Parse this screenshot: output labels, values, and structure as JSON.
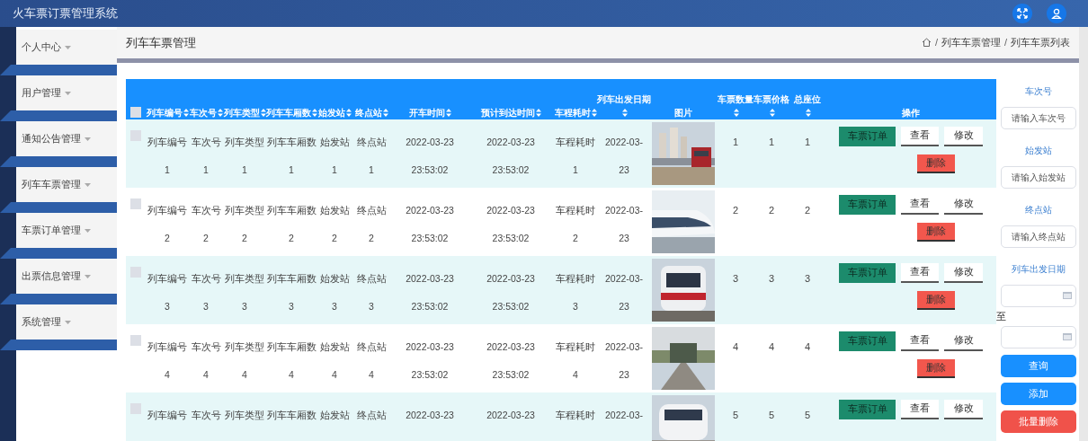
{
  "app_title": "火车票订票管理系统",
  "sidebar": {
    "items": [
      {
        "label": "个人中心"
      },
      {
        "label": "用户管理"
      },
      {
        "label": "通知公告管理"
      },
      {
        "label": "列车车票管理"
      },
      {
        "label": "车票订单管理"
      },
      {
        "label": "出票信息管理"
      },
      {
        "label": "系统管理"
      }
    ]
  },
  "page_title": "列车车票管理",
  "breadcrumb": [
    {
      "kind": "separator",
      "text": "/"
    },
    {
      "kind": "link",
      "text": "列车车票管理"
    },
    {
      "kind": "separator",
      "text": "/"
    },
    {
      "kind": "link",
      "text": "列车车票列表"
    }
  ],
  "table": {
    "select_all_checked": false,
    "columns": [
      {
        "label": "列车编号",
        "sortable": true
      },
      {
        "label": "车次号",
        "sortable": true
      },
      {
        "label": "列车类型",
        "sortable": true
      },
      {
        "label": "列车车厢数",
        "sortable": true
      },
      {
        "label": "始发站",
        "sortable": true
      },
      {
        "label": "终点站",
        "sortable": true
      },
      {
        "label": "开车时间",
        "sortable": true
      },
      {
        "label": "预计到达时间",
        "sortable": true
      },
      {
        "label": "车程耗时",
        "sortable": true
      },
      {
        "top_label": "列车出发日期",
        "sortable": true
      },
      {
        "label": "图片",
        "sortable": false
      },
      {
        "top_label": "车票数量",
        "sortable": true
      },
      {
        "top_label": "车票价格",
        "sortable": true
      },
      {
        "top_label": "总座位",
        "sortable": true
      },
      {
        "label": "操作",
        "sortable": false
      }
    ],
    "rows": [
      {
        "checked": false,
        "cells": [
          [
            "列车编号",
            "1"
          ],
          [
            "车次号",
            "1"
          ],
          [
            "列车类型",
            "1"
          ],
          [
            "列车车厢数",
            "1"
          ],
          [
            "始发站",
            "1"
          ],
          [
            "终点站",
            "1"
          ],
          [
            "2022-03-23",
            "23:53:02"
          ],
          [
            "2022-03-23",
            "23:53:02"
          ],
          [
            "车程耗时",
            "1"
          ],
          [
            "2022-03-",
            "23"
          ]
        ],
        "counts": [
          "1",
          "1",
          "1"
        ],
        "actions": [
          {
            "label": "车票订单",
            "kind": "order"
          },
          {
            "label": "查看",
            "kind": "view"
          },
          {
            "label": "修改",
            "kind": "edit"
          },
          {
            "label": "删除",
            "kind": "delete"
          }
        ]
      },
      {
        "checked": false,
        "cells": [
          [
            "列车编号",
            "2"
          ],
          [
            "车次号",
            "2"
          ],
          [
            "列车类型",
            "2"
          ],
          [
            "列车车厢数",
            "2"
          ],
          [
            "始发站",
            "2"
          ],
          [
            "终点站",
            "2"
          ],
          [
            "2022-03-23",
            "23:53:02"
          ],
          [
            "2022-03-23",
            "23:53:02"
          ],
          [
            "车程耗时",
            "2"
          ],
          [
            "2022-03-",
            "23"
          ]
        ],
        "counts": [
          "2",
          "2",
          "2"
        ],
        "actions": [
          {
            "label": "车票订单",
            "kind": "order"
          },
          {
            "label": "查看",
            "kind": "view"
          },
          {
            "label": "修改",
            "kind": "edit"
          },
          {
            "label": "删除",
            "kind": "delete"
          }
        ]
      },
      {
        "checked": false,
        "cells": [
          [
            "列车编号",
            "3"
          ],
          [
            "车次号",
            "3"
          ],
          [
            "列车类型",
            "3"
          ],
          [
            "列车车厢数",
            "3"
          ],
          [
            "始发站",
            "3"
          ],
          [
            "终点站",
            "3"
          ],
          [
            "2022-03-23",
            "23:53:02"
          ],
          [
            "2022-03-23",
            "23:53:02"
          ],
          [
            "车程耗时",
            "3"
          ],
          [
            "2022-03-",
            "23"
          ]
        ],
        "counts": [
          "3",
          "3",
          "3"
        ],
        "actions": [
          {
            "label": "车票订单",
            "kind": "order"
          },
          {
            "label": "查看",
            "kind": "view"
          },
          {
            "label": "修改",
            "kind": "edit"
          },
          {
            "label": "删除",
            "kind": "delete"
          }
        ]
      },
      {
        "checked": false,
        "cells": [
          [
            "列车编号",
            "4"
          ],
          [
            "车次号",
            "4"
          ],
          [
            "列车类型",
            "4"
          ],
          [
            "列车车厢数",
            "4"
          ],
          [
            "始发站",
            "4"
          ],
          [
            "终点站",
            "4"
          ],
          [
            "2022-03-23",
            "23:53:02"
          ],
          [
            "2022-03-23",
            "23:53:02"
          ],
          [
            "车程耗时",
            "4"
          ],
          [
            "2022-03-",
            "23"
          ]
        ],
        "counts": [
          "4",
          "4",
          "4"
        ],
        "actions": [
          {
            "label": "车票订单",
            "kind": "order"
          },
          {
            "label": "查看",
            "kind": "view"
          },
          {
            "label": "修改",
            "kind": "edit"
          },
          {
            "label": "删除",
            "kind": "delete"
          }
        ]
      },
      {
        "checked": false,
        "cells": [
          [
            "列车编号"
          ],
          [
            "车次号"
          ],
          [
            "列车类型"
          ],
          [
            "列车车厢数"
          ],
          [
            "始发站"
          ],
          [
            "终点站"
          ],
          [
            "2022-03-23"
          ],
          [
            "2022-03-23"
          ],
          [
            "车程耗时"
          ],
          [
            "2022-03-"
          ]
        ],
        "counts": [
          "5",
          "5",
          "5"
        ],
        "actions": [
          {
            "label": "车票订单",
            "kind": "order"
          },
          {
            "label": "查看",
            "kind": "view"
          },
          {
            "label": "修改",
            "kind": "edit"
          }
        ]
      }
    ]
  },
  "filters": [
    {
      "kind": "text",
      "label": "车次号",
      "placeholder": "请输入车次号"
    },
    {
      "kind": "text",
      "label": "始发站",
      "placeholder": "请输入始发站"
    },
    {
      "kind": "text",
      "label": "终点站",
      "placeholder": "请输入终点站"
    },
    {
      "kind": "daterange",
      "label": "列车出发日期",
      "separator": "至"
    }
  ],
  "filter_buttons": [
    {
      "label": "查询",
      "kind": "primary"
    },
    {
      "label": "添加",
      "kind": "primary"
    },
    {
      "label": "批量删除",
      "kind": "danger"
    }
  ]
}
